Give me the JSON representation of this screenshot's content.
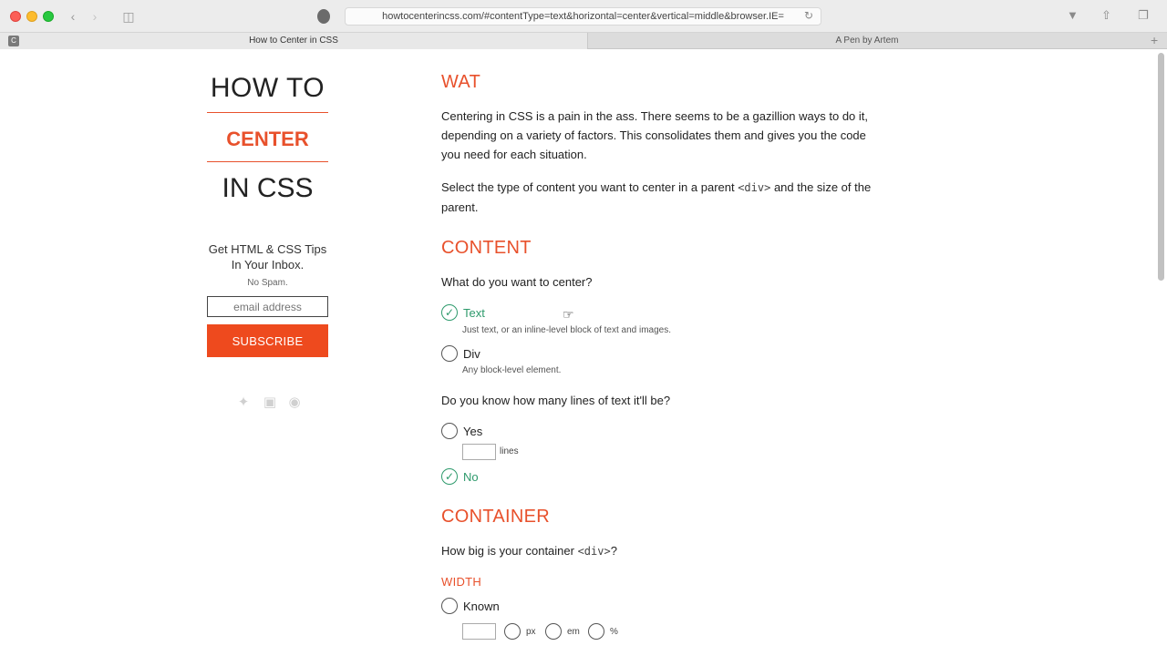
{
  "browser": {
    "url": "howtocenterincss.com/#contentType=text&horizontal=center&vertical=middle&browser.IE=",
    "tabs": [
      {
        "label": "How to Center in CSS",
        "favicon": "C"
      },
      {
        "label": "A Pen by Artem"
      }
    ]
  },
  "sidebar": {
    "logo": {
      "line1": "HOW TO",
      "line2": "CENTER",
      "line3": "IN CSS"
    },
    "newsletter": {
      "tips": "Get HTML & CSS Tips In Your Inbox.",
      "nospam": "No Spam.",
      "email_placeholder": "email address",
      "subscribe_label": "SUBSCRIBE"
    },
    "social_icons": [
      "twitter-icon",
      "facebook-icon",
      "github-icon"
    ]
  },
  "main": {
    "wat": {
      "heading": "WAT",
      "para1": "Centering in CSS is a pain in the ass. There seems to be a gazillion ways to do it, depending on a variety of factors. This consolidates them and gives you the code you need for each situation.",
      "para2_a": "Select the type of content you want to center in a parent ",
      "para2_code": "<div>",
      "para2_b": " and the size of the parent."
    },
    "content": {
      "heading": "CONTENT",
      "question": "What do you want to center?",
      "options": [
        {
          "label": "Text",
          "desc": "Just text, or an inline-level block of text and images.",
          "checked": true
        },
        {
          "label": "Div",
          "desc": "Any block-level element.",
          "checked": false
        }
      ],
      "lines_question": "Do you know how many lines of text it'll be?",
      "lines_options": [
        {
          "label": "Yes",
          "checked": false,
          "suffix": "lines"
        },
        {
          "label": "No",
          "checked": true
        }
      ]
    },
    "container": {
      "heading": "CONTAINER",
      "question_a": "How big is your container ",
      "question_code": "<div>",
      "question_b": "?",
      "width_heading": "WIDTH",
      "width_options": [
        {
          "label": "Known",
          "checked": false
        }
      ],
      "units": [
        "px",
        "em",
        "%"
      ]
    }
  },
  "colors": {
    "accent": "#e8512c",
    "subscribe": "#ee4a1e",
    "checked": "#2e9a6c"
  }
}
